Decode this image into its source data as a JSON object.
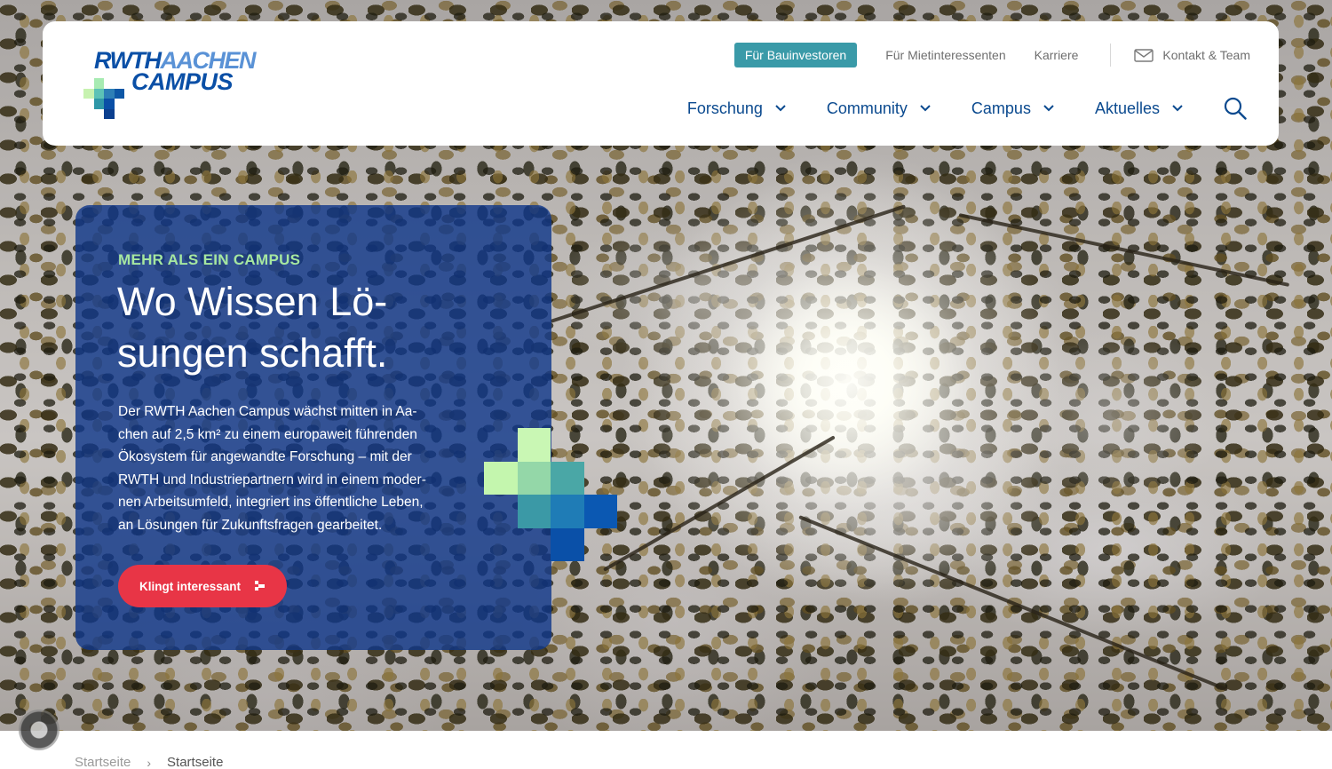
{
  "brand": {
    "logo_line1_a": "RWTH",
    "logo_line1_b": "AACHEN",
    "logo_line2": "CAMPUS",
    "colors": {
      "dark_blue": "#0a4fa6",
      "light_blue": "#5a92d6",
      "teal": "#3a9aa8",
      "green": "#a6e7a0",
      "red": "#e83546"
    }
  },
  "topnav": {
    "investors": "Für Bauinvestoren",
    "tenants": "Für Mietinteressenten",
    "careers": "Karriere",
    "contact": "Kontakt & Team",
    "contact_icon": "mail-icon"
  },
  "mainnav": {
    "items": [
      {
        "label": "Forschung"
      },
      {
        "label": "Community"
      },
      {
        "label": "Campus"
      },
      {
        "label": "Aktuelles"
      }
    ],
    "search_icon": "search-icon"
  },
  "hero": {
    "kicker": "MEHR ALS EIN CAMPUS",
    "headline": "Wo Wissen Lö-\nsungen schafft.",
    "intro": "Der RWTH Aachen Campus wächst mitten in Aa-\nchen auf 2,5 km² zu einem europaweit führenden\nÖkosystem für angewandte Forschung – mit der\nRWTH und Industriepartnern wird in einem moder-\nnen Arbeitsumfeld, integriert ins öffentliche Leben,\nan Lösungen für Zukunftsfragen gearbeitet.",
    "cta": "Klingt interessant"
  },
  "breadcrumb": {
    "home": "Startseite",
    "current": "Startseite"
  }
}
